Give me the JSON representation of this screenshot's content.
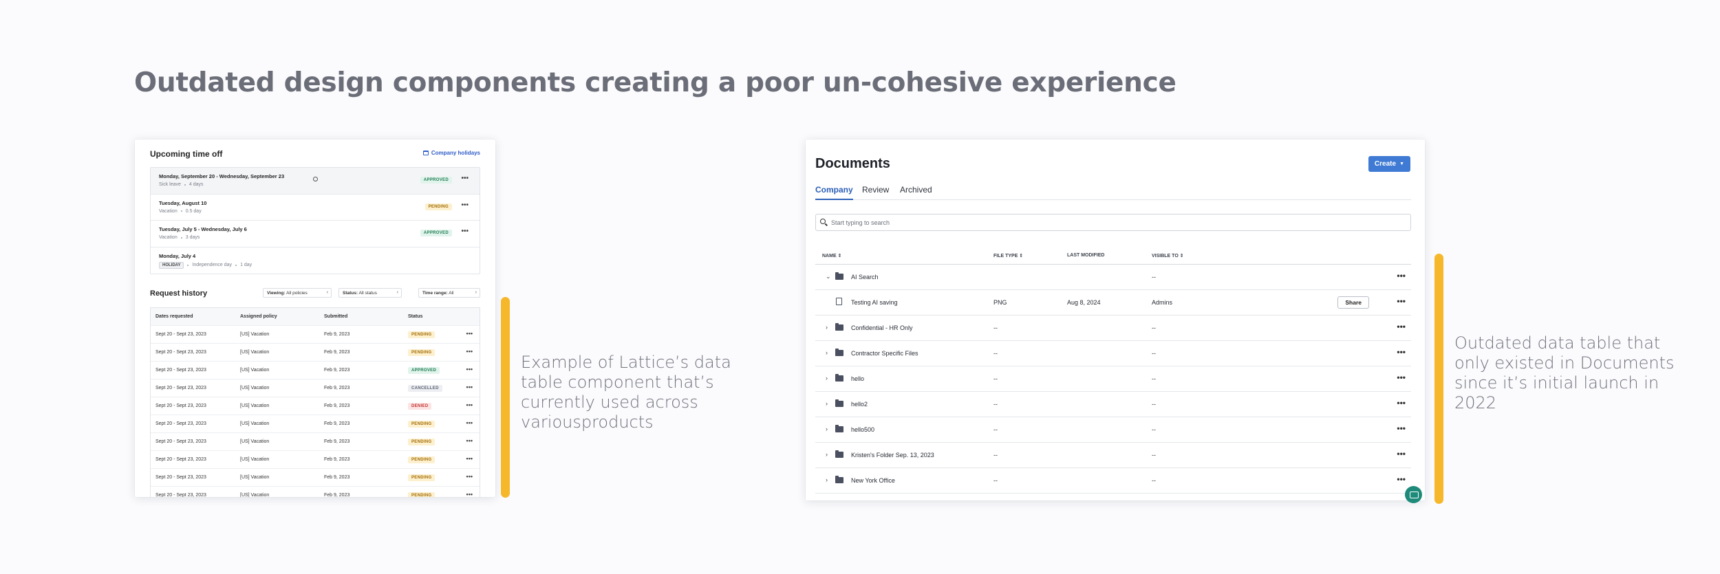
{
  "title": "Outdated design components creating a poor un-cohesive experience",
  "captions": {
    "left": "Example of Lattice’s data table component that’s currently used across variousproducts",
    "right": "Outdated data table that only existed in Documents since it’s initial launch in 2022"
  },
  "colors": {
    "accent": "#f6b72b",
    "title": "#6b6e78",
    "primary": "#3f7bd4"
  },
  "lattice": {
    "upcoming_title": "Upcoming time off",
    "company_holidays": "Company holidays",
    "upcoming": [
      {
        "date": "Monday, September 20 - Wednesday, September 23",
        "type": "Sick leave",
        "duration": "4 days",
        "status": "APPROVED"
      },
      {
        "date": "Tuesday, August 10",
        "type": "Vacation",
        "duration": "0.5 day",
        "status": "PENDING"
      },
      {
        "date": "Tuesday, July 5 - Wednesday, July 6",
        "type": "Vacation",
        "duration": "3 days",
        "status": "APPROVED"
      },
      {
        "date": "Monday, July 4",
        "chip": "HOLIDAY",
        "type": "Independence day",
        "duration": "1 day",
        "status": ""
      }
    ],
    "request_history_title": "Request history",
    "filters": {
      "viewing_label": "Viewing:",
      "viewing_value": "All policies",
      "status_label": "Status:",
      "status_value": "All status",
      "time_label": "Time range:",
      "time_value": "All"
    },
    "columns": [
      "Dates requested",
      "Assigned policy",
      "Submitted",
      "Status"
    ],
    "rows": [
      {
        "dates": "Sept 20 - Sept 23, 2023",
        "policy": "[US] Vacation",
        "submitted": "Feb 9, 2023",
        "status": "PENDING"
      },
      {
        "dates": "Sept 20 - Sept 23, 2023",
        "policy": "[US] Vacation",
        "submitted": "Feb 9, 2023",
        "status": "PENDING"
      },
      {
        "dates": "Sept 20 - Sept 23, 2023",
        "policy": "[US] Vacation",
        "submitted": "Feb 9, 2023",
        "status": "APPROVED"
      },
      {
        "dates": "Sept 20 - Sept 23, 2023",
        "policy": "[US] Vacation",
        "submitted": "Feb 9, 2023",
        "status": "CANCELLED"
      },
      {
        "dates": "Sept 20 - Sept 23, 2023",
        "policy": "[US] Vacation",
        "submitted": "Feb 9, 2023",
        "status": "DENIED"
      },
      {
        "dates": "Sept 20 - Sept 23, 2023",
        "policy": "[US] Vacation",
        "submitted": "Feb 9, 2023",
        "status": "PENDING"
      },
      {
        "dates": "Sept 20 - Sept 23, 2023",
        "policy": "[US] Vacation",
        "submitted": "Feb 9, 2023",
        "status": "PENDING"
      },
      {
        "dates": "Sept 20 - Sept 23, 2023",
        "policy": "[US] Vacation",
        "submitted": "Feb 9, 2023",
        "status": "PENDING"
      },
      {
        "dates": "Sept 20 - Sept 23, 2023",
        "policy": "[US] Vacation",
        "submitted": "Feb 9, 2023",
        "status": "PENDING"
      },
      {
        "dates": "Sept 20 - Sept 23, 2023",
        "policy": "[US] Vacation",
        "submitted": "Feb 9, 2023",
        "status": "PENDING"
      }
    ],
    "more_icon": "•••"
  },
  "documents": {
    "title": "Documents",
    "create_label": "Create",
    "tabs": [
      "Company",
      "Review",
      "Archived"
    ],
    "search_placeholder": "Start typing to search",
    "columns": [
      "NAME",
      "FILE TYPE",
      "LAST MODIFIED",
      "VISIBLE TO"
    ],
    "rows": [
      {
        "kind": "folder",
        "expanded": true,
        "name": "AI Search",
        "file_type": "",
        "modified": "",
        "visible": "--"
      },
      {
        "kind": "file",
        "name": "Testing AI saving",
        "file_type": "PNG",
        "modified": "Aug 8, 2024",
        "visible": "Admins",
        "share": "Share"
      },
      {
        "kind": "folder",
        "name": "Confidential - HR Only",
        "file_type": "--",
        "modified": "",
        "visible": "--"
      },
      {
        "kind": "folder",
        "name": "Contractor Specific Files",
        "file_type": "--",
        "modified": "",
        "visible": "--"
      },
      {
        "kind": "folder",
        "name": "hello",
        "file_type": "--",
        "modified": "",
        "visible": "--"
      },
      {
        "kind": "folder",
        "name": "hello2",
        "file_type": "--",
        "modified": "",
        "visible": "--"
      },
      {
        "kind": "folder",
        "name": "hello500",
        "file_type": "--",
        "modified": "",
        "visible": "--"
      },
      {
        "kind": "folder",
        "name": "Kristen's Folder Sep. 13, 2023",
        "file_type": "--",
        "modified": "",
        "visible": "--"
      },
      {
        "kind": "folder",
        "name": "New York Office",
        "file_type": "--",
        "modified": "",
        "visible": "--"
      }
    ],
    "more_icon": "•••"
  }
}
